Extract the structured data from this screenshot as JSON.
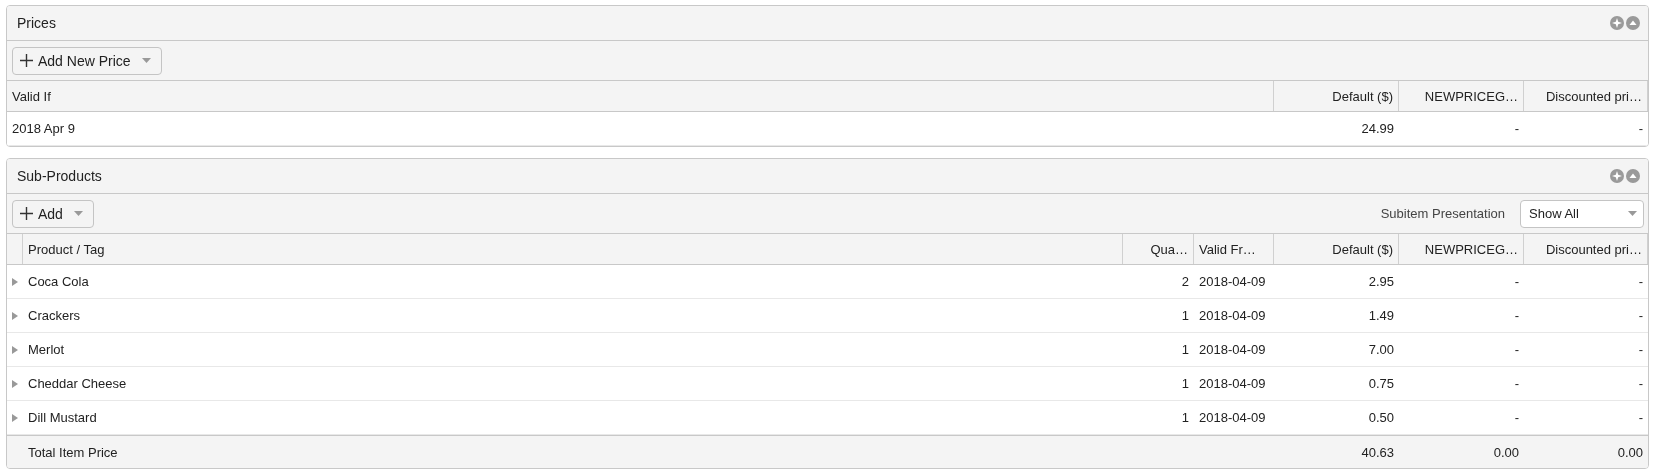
{
  "prices": {
    "title": "Prices",
    "add_button": "Add New Price",
    "columns": [
      "Valid If",
      "Default ($)",
      "NEWPRICEG…",
      "Discounted pri…"
    ],
    "rows": [
      {
        "cells": [
          "2018 Apr 9",
          "24.99",
          "-",
          "-"
        ]
      }
    ]
  },
  "sub_products": {
    "title": "Sub-Products",
    "add_button": "Add",
    "subitem_presentation": {
      "label": "Subitem Presentation",
      "value": "Show All"
    },
    "columns": [
      "Product / Tag",
      "Qua…",
      "Valid Fr…",
      "Default ($)",
      "NEWPRICEG…",
      "Discounted pri…"
    ],
    "rows": [
      {
        "expanded": false,
        "cells": [
          "Coca Cola",
          "2",
          "2018-04-09",
          "2.95",
          "-",
          "-"
        ]
      },
      {
        "expanded": false,
        "cells": [
          "Crackers",
          "1",
          "2018-04-09",
          "1.49",
          "-",
          "-"
        ]
      },
      {
        "expanded": false,
        "cells": [
          "Merlot",
          "1",
          "2018-04-09",
          "7.00",
          "-",
          "-"
        ]
      },
      {
        "expanded": false,
        "cells": [
          "Cheddar Cheese",
          "1",
          "2018-04-09",
          "0.75",
          "-",
          "-"
        ]
      },
      {
        "expanded": false,
        "cells": [
          "Dill Mustard",
          "1",
          "2018-04-09",
          "0.50",
          "-",
          "-"
        ]
      }
    ],
    "total": {
      "label": "Total Item Price",
      "values": [
        "40.63",
        "0.00",
        "0.00"
      ]
    }
  }
}
